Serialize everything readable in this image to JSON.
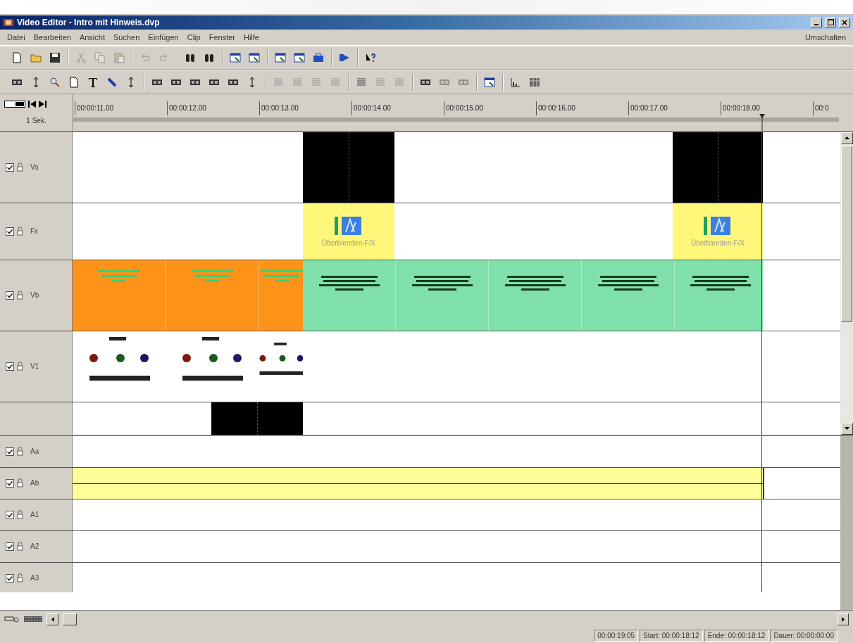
{
  "window": {
    "title": "Video Editor - Intro mit Hinweis.dvp"
  },
  "menu": {
    "items": [
      "Datei",
      "Bearbeiten",
      "Ansicht",
      "Suchen",
      "Einfügen",
      "Clip",
      "Fenster",
      "Hilfe"
    ],
    "right": "Umschalten"
  },
  "toolbars": [
    [
      [
        {
          "disabled": false
        },
        {
          "disabled": false
        },
        {
          "disabled": false
        }
      ],
      [
        {
          "disabled": true
        },
        {
          "disabled": true
        },
        {
          "disabled": true
        }
      ],
      [
        {
          "disabled": true
        },
        {
          "disabled": true
        }
      ],
      [
        {
          "disabled": false
        },
        {
          "disabled": false
        }
      ],
      [
        {
          "disabled": false
        },
        {
          "disabled": false
        }
      ],
      [
        {
          "disabled": false
        },
        {
          "disabled": false
        },
        {
          "disabled": false
        }
      ],
      [
        {
          "disabled": false
        }
      ],
      [
        {
          "disabled": false
        }
      ]
    ],
    [
      [
        {
          "disabled": false
        },
        {
          "disabled": false
        },
        {
          "disabled": false
        },
        {
          "disabled": false
        },
        {
          "disabled": false
        },
        {
          "disabled": false
        },
        {
          "disabled": false
        }
      ],
      [
        {
          "disabled": false
        },
        {
          "disabled": false
        },
        {
          "disabled": false
        },
        {
          "disabled": false
        },
        {
          "disabled": false
        },
        {
          "disabled": false
        }
      ],
      [
        {
          "disabled": true
        },
        {
          "disabled": true
        },
        {
          "disabled": true
        },
        {
          "disabled": true
        }
      ],
      [
        {
          "disabled": false
        },
        {
          "disabled": true
        },
        {
          "disabled": true
        }
      ],
      [
        {
          "disabled": false
        },
        {
          "disabled": true
        },
        {
          "disabled": true
        }
      ],
      [
        {
          "disabled": false
        }
      ],
      [
        {
          "disabled": false
        },
        {
          "disabled": false
        }
      ]
    ]
  ],
  "ruler": {
    "scale": "1 Sek.",
    "ticks": [
      "00:00:11.00",
      "00:00:12.00",
      "00:00:13.00",
      "00:00:14.00",
      "00:00:15.00",
      "00:00:16.00",
      "00:00:17.00",
      "00:00:18.00",
      "00:0"
    ]
  },
  "video_tracks": [
    {
      "name": "Va",
      "visible": true,
      "locked": false,
      "clips": [
        {
          "kind": "black"
        },
        {
          "kind": "black"
        }
      ]
    },
    {
      "name": "Fx",
      "visible": true,
      "locked": false,
      "clips": [
        {
          "kind": "transition",
          "label": "Überblenden-F/X"
        },
        {
          "kind": "transition",
          "label": "Überblenden-F/X"
        }
      ]
    },
    {
      "name": "Vb",
      "visible": true,
      "locked": false,
      "clips": [
        {
          "kind": "orange_title"
        },
        {
          "kind": "green_title"
        }
      ]
    },
    {
      "name": "V1",
      "visible": true,
      "locked": false,
      "clips": [
        {
          "kind": "logo"
        }
      ]
    },
    {
      "clips": [
        {
          "kind": "black"
        }
      ]
    }
  ],
  "audio_tracks": [
    {
      "name": "Aa",
      "visible": true,
      "locked": false
    },
    {
      "name": "Ab",
      "visible": true,
      "locked": false,
      "clips": [
        {
          "kind": "audio"
        }
      ]
    },
    {
      "name": "A1",
      "visible": true,
      "locked": false
    },
    {
      "name": "A2",
      "visible": true,
      "locked": false
    },
    {
      "name": "A3",
      "visible": true,
      "locked": false
    }
  ],
  "status_bar": [
    "00:00:19:05",
    "Start: 00:00:18:12",
    "Ende: 00:00:18:12",
    "Dauer: 00:00:00:00"
  ]
}
